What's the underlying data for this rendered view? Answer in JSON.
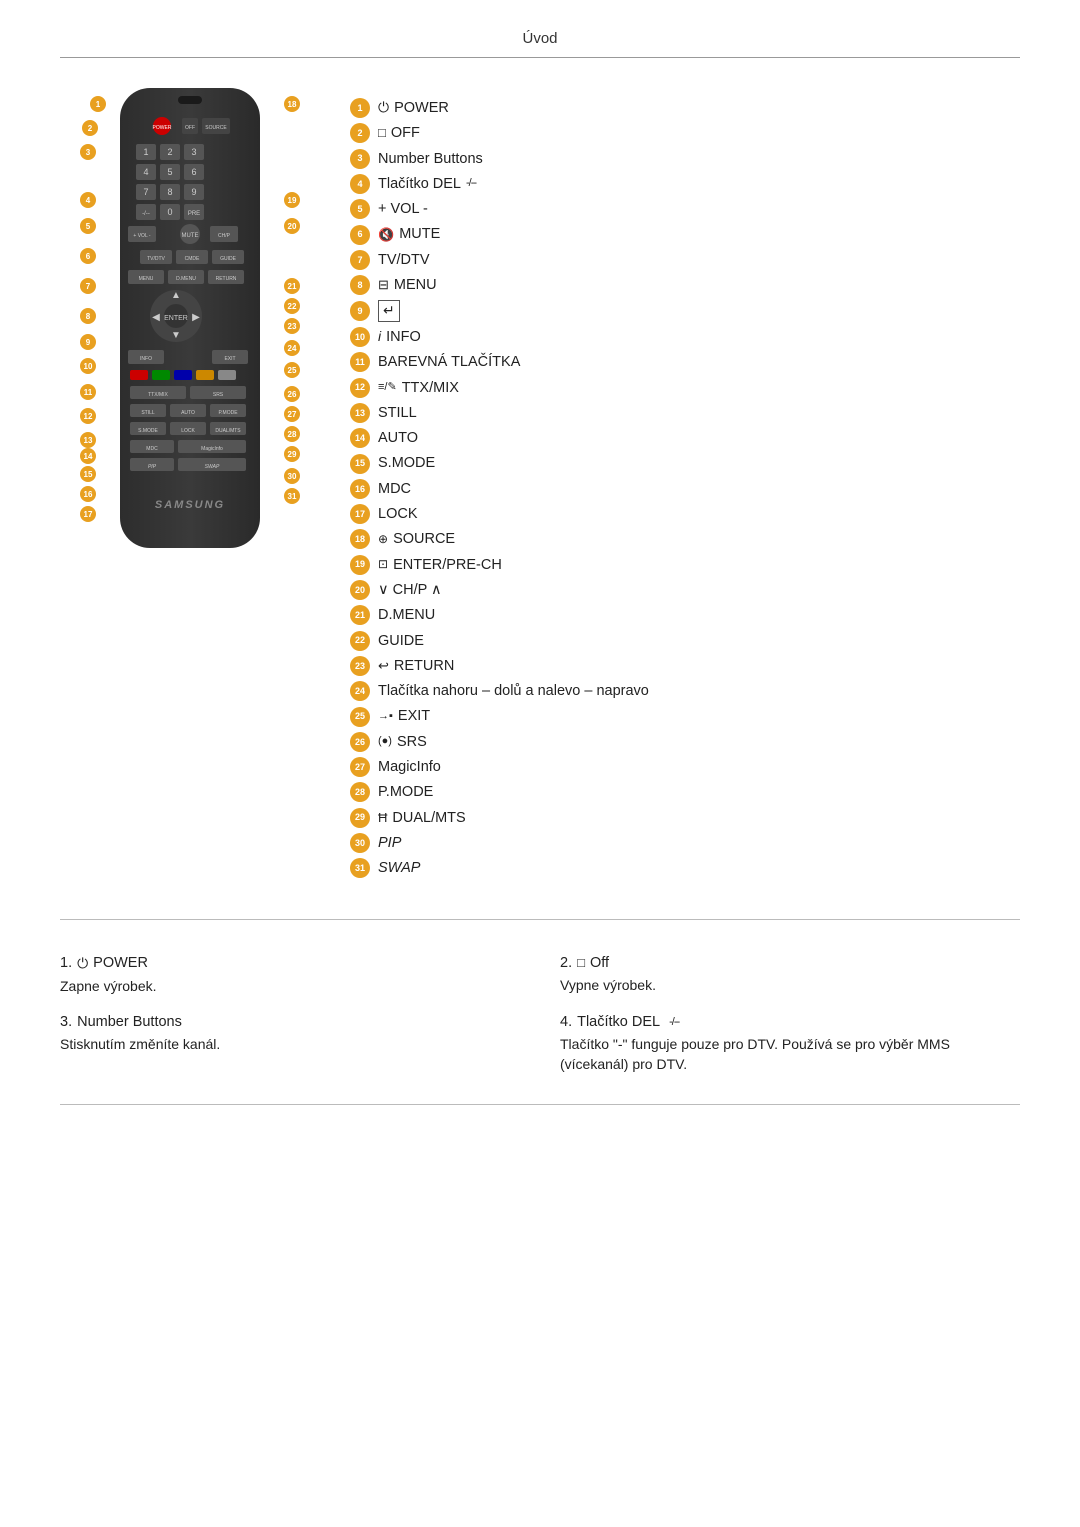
{
  "header": {
    "title": "Úvod"
  },
  "legend": {
    "items": [
      {
        "num": "1",
        "icon": "power",
        "text": "POWER"
      },
      {
        "num": "2",
        "icon": "square",
        "text": "OFF"
      },
      {
        "num": "3",
        "icon": "",
        "text": "Number Buttons"
      },
      {
        "num": "4",
        "icon": "del",
        "text": "Tlačítko DEL"
      },
      {
        "num": "5",
        "icon": "",
        "text": "+ VOL -"
      },
      {
        "num": "6",
        "icon": "mute",
        "text": "MUTE"
      },
      {
        "num": "7",
        "icon": "",
        "text": "TV/DTV"
      },
      {
        "num": "8",
        "icon": "menu",
        "text": "MENU"
      },
      {
        "num": "9",
        "icon": "enter",
        "text": ""
      },
      {
        "num": "10",
        "icon": "info",
        "text": "INFO"
      },
      {
        "num": "11",
        "icon": "",
        "text": "BAREVNÁ TLAČÍTKA"
      },
      {
        "num": "12",
        "icon": "ttx",
        "text": "TTX/MIX"
      },
      {
        "num": "13",
        "icon": "",
        "text": "STILL"
      },
      {
        "num": "14",
        "icon": "",
        "text": "AUTO"
      },
      {
        "num": "15",
        "icon": "",
        "text": "S.MODE"
      },
      {
        "num": "16",
        "icon": "",
        "text": "MDC"
      },
      {
        "num": "17",
        "icon": "",
        "text": "LOCK"
      },
      {
        "num": "18",
        "icon": "source",
        "text": "SOURCE"
      },
      {
        "num": "19",
        "icon": "enterpre",
        "text": "ENTER/PRE-CH"
      },
      {
        "num": "20",
        "icon": "",
        "text": "∨ CH/P ∧"
      },
      {
        "num": "21",
        "icon": "",
        "text": "D.MENU"
      },
      {
        "num": "22",
        "icon": "",
        "text": "GUIDE"
      },
      {
        "num": "23",
        "icon": "return",
        "text": "RETURN"
      },
      {
        "num": "24",
        "icon": "",
        "text": "Tlačítka nahoru – dolů a nalevo – napravo"
      },
      {
        "num": "25",
        "icon": "exit",
        "text": "EXIT"
      },
      {
        "num": "26",
        "icon": "srs",
        "text": "SRS"
      },
      {
        "num": "27",
        "icon": "",
        "text": "MagicInfo"
      },
      {
        "num": "28",
        "icon": "",
        "text": "P.MODE"
      },
      {
        "num": "29",
        "icon": "dual",
        "text": "DUAL/MTS"
      },
      {
        "num": "30",
        "icon": "",
        "text": "PIP",
        "italic": true
      },
      {
        "num": "31",
        "icon": "",
        "text": "SWAP",
        "italic": true
      }
    ]
  },
  "descriptions": [
    {
      "num": "1",
      "title_icon": "power",
      "title": "POWER",
      "body": "Zapne výrobek."
    },
    {
      "num": "2",
      "title_icon": "square",
      "title": "Off",
      "body": "Vypne výrobek."
    },
    {
      "num": "3",
      "title_icon": "",
      "title": "Number Buttons",
      "body": "Stisknutím změníte kanál."
    },
    {
      "num": "4",
      "title_icon": "del",
      "title": "Tlačítko DEL",
      "body": "Tlačítko \"-\" funguje pouze pro DTV. Používá se pro výběr MMS (vícekanál) pro DTV."
    }
  ],
  "remote": {
    "brand": "SAMSUNG",
    "button_labels": {
      "power": "POWER",
      "off": "OFF SOURCE",
      "vol_up": "+",
      "vol_down": "-",
      "mute": "MUTE",
      "tv_dtv": "TV/DTV",
      "menu": "MENU",
      "return": "RETURN",
      "info": "INFO",
      "exit": "EXIT",
      "still": "STILL",
      "auto": "AUTO",
      "s_mode": "S.MODE",
      "lock": "LOCK",
      "mdc": "MDC",
      "magicinfo": "MagicInfo",
      "pip": "PIP",
      "swap": "SWAP",
      "dual_mts": "DUAL/MTS",
      "p_mode": "P.MODE"
    }
  }
}
